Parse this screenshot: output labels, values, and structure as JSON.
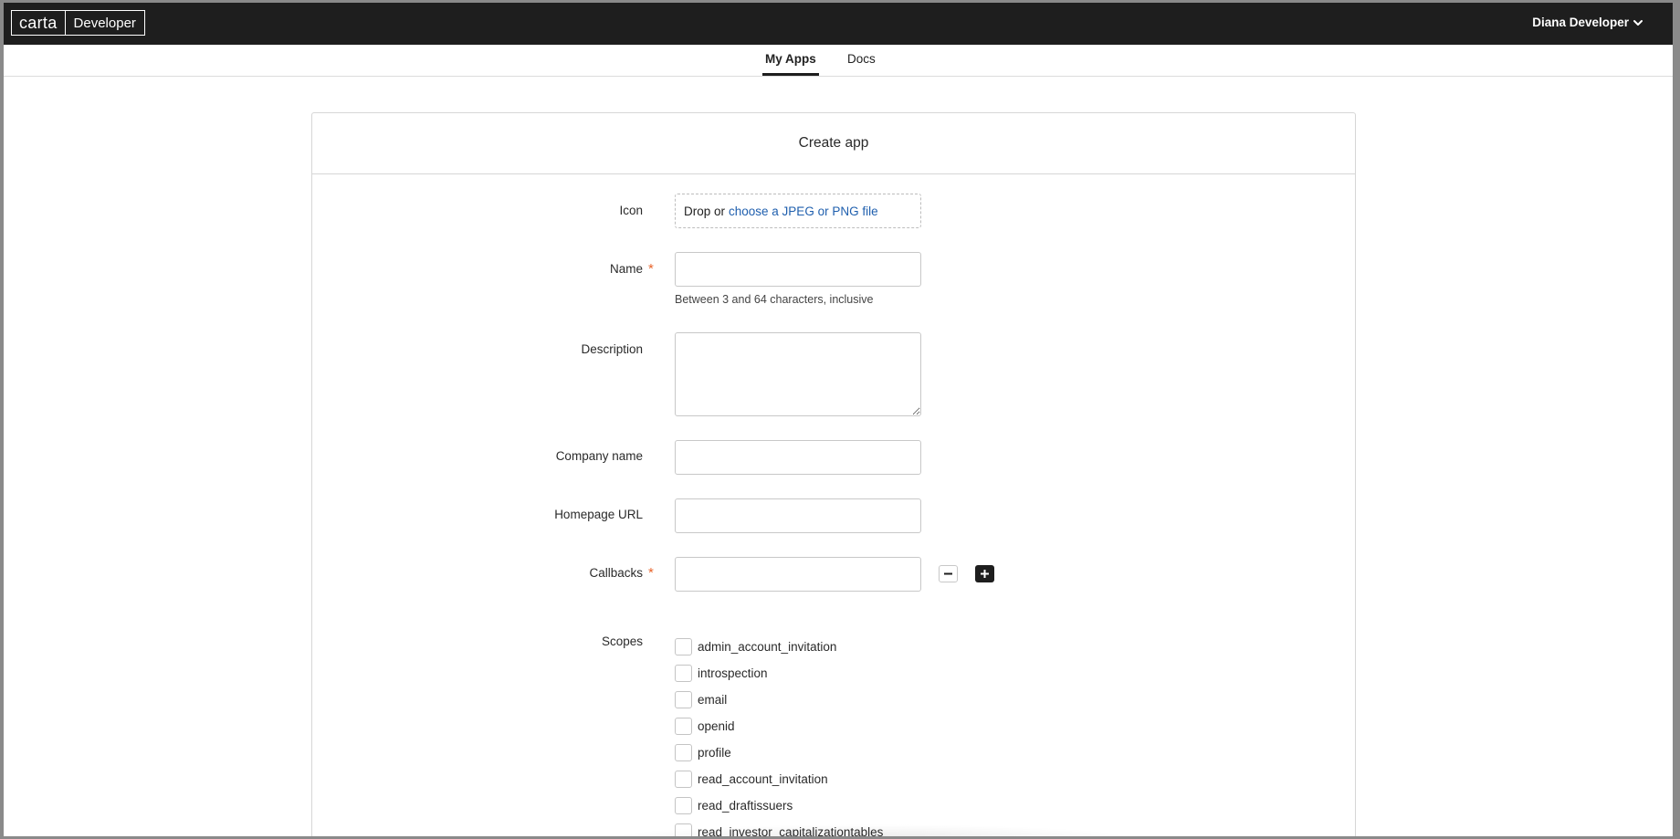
{
  "header": {
    "brand": "carta",
    "product": "Developer",
    "user_name": "Diana Developer",
    "user_menu_icon": "chevron-down-icon"
  },
  "nav": {
    "tabs": [
      {
        "label": "My Apps",
        "active": true
      },
      {
        "label": "Docs",
        "active": false
      }
    ]
  },
  "form": {
    "title": "Create app",
    "icon": {
      "label": "Icon",
      "drop_text": "Drop or",
      "choose_link": "choose a JPEG or PNG file"
    },
    "name": {
      "label": "Name",
      "required_mark": "*",
      "value": "",
      "help": "Between 3 and 64 characters, inclusive"
    },
    "description": {
      "label": "Description",
      "value": ""
    },
    "company_name": {
      "label": "Company name",
      "value": ""
    },
    "homepage_url": {
      "label": "Homepage URL",
      "value": ""
    },
    "callbacks": {
      "label": "Callbacks",
      "required_mark": "*",
      "value": "",
      "remove_icon": "minus-icon",
      "add_icon": "plus-icon"
    },
    "scopes": {
      "label": "Scopes",
      "items": [
        {
          "label": "admin_account_invitation",
          "checked": false
        },
        {
          "label": "introspection",
          "checked": false
        },
        {
          "label": "email",
          "checked": false
        },
        {
          "label": "openid",
          "checked": false
        },
        {
          "label": "profile",
          "checked": false
        },
        {
          "label": "read_account_invitation",
          "checked": false
        },
        {
          "label": "read_draftissuers",
          "checked": false
        },
        {
          "label": "read_investor_capitalizationtables",
          "checked": false
        }
      ]
    }
  },
  "colors": {
    "topbar": "#1e1e1e",
    "link": "#1f5fae",
    "required": "#e8642c",
    "border": "#d6d6d6"
  }
}
